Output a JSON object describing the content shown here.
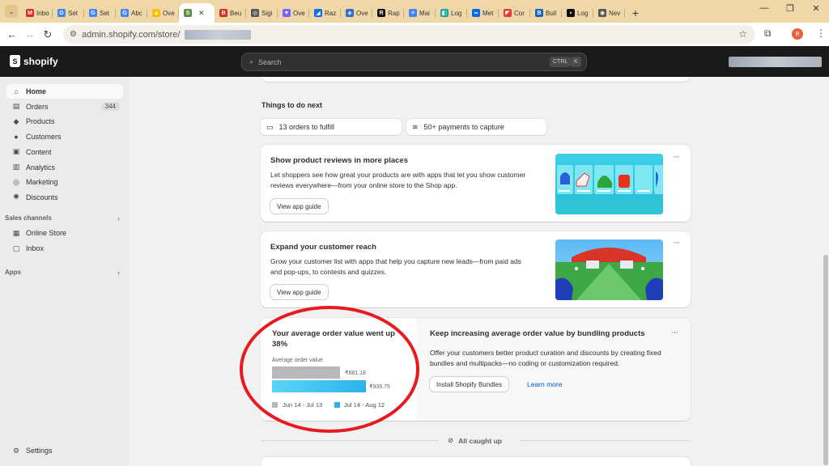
{
  "browser": {
    "tabs": [
      {
        "label": "Inbo",
        "icon": "gmail-icon",
        "color": "#d93025",
        "glyph": "M"
      },
      {
        "label": "Set",
        "icon": "google-icon",
        "color": "#4285f4",
        "glyph": "G"
      },
      {
        "label": "Set",
        "icon": "google-icon",
        "color": "#4285f4",
        "glyph": "G"
      },
      {
        "label": "Abc",
        "icon": "google-icon",
        "color": "#4285f4",
        "glyph": "G"
      },
      {
        "label": "Ove",
        "icon": "google-ads-icon",
        "color": "#fbbc04",
        "glyph": "▲"
      },
      {
        "label": "",
        "icon": "shopify-icon",
        "color": "#5e8e3e",
        "glyph": "S",
        "active": true
      },
      {
        "label": "Beu",
        "icon": "app-icon",
        "color": "#d93025",
        "glyph": "B"
      },
      {
        "label": "Sigi",
        "icon": "globe-icon",
        "color": "#555555",
        "glyph": "◎"
      },
      {
        "label": "Ove",
        "icon": "app-icon",
        "color": "#7b61ff",
        "glyph": "▼"
      },
      {
        "label": "Raz",
        "icon": "razorpay-icon",
        "color": "#0c6ded",
        "glyph": "◢"
      },
      {
        "label": "Ove",
        "icon": "app-icon",
        "color": "#2c6ecb",
        "glyph": "◈"
      },
      {
        "label": "Rap",
        "icon": "app-icon",
        "color": "#111111",
        "glyph": "R"
      },
      {
        "label": "Mai",
        "icon": "docs-icon",
        "color": "#4285f4",
        "glyph": "≡"
      },
      {
        "label": "Log",
        "icon": "app-icon",
        "color": "#1aa3a3",
        "glyph": "◧"
      },
      {
        "label": "Met",
        "icon": "meta-icon",
        "color": "#0866ff",
        "glyph": "∞"
      },
      {
        "label": "Cor",
        "icon": "app-icon",
        "color": "#e53935",
        "glyph": "◤"
      },
      {
        "label": "Buil",
        "icon": "app-icon",
        "color": "#1565c0",
        "glyph": "B"
      },
      {
        "label": "Log",
        "icon": "app-icon",
        "color": "#111111",
        "glyph": "▪"
      },
      {
        "label": "Nev",
        "icon": "chrome-icon",
        "color": "#555555",
        "glyph": "◉"
      }
    ],
    "url": "admin.shopify.com/store/",
    "profile_initial": "B"
  },
  "topbar": {
    "brand": "shopify",
    "search_placeholder": "Search",
    "shortcut_key1": "CTRL",
    "shortcut_key2": "K"
  },
  "sidebar": {
    "items": [
      {
        "label": "Home",
        "icon": "home-icon",
        "glyph": "⌂",
        "active": true
      },
      {
        "label": "Orders",
        "icon": "orders-icon",
        "glyph": "▤",
        "badge": "344"
      },
      {
        "label": "Products",
        "icon": "tag-icon",
        "glyph": "◆"
      },
      {
        "label": "Customers",
        "icon": "person-icon",
        "glyph": "●"
      },
      {
        "label": "Content",
        "icon": "content-icon",
        "glyph": "▣"
      },
      {
        "label": "Analytics",
        "icon": "analytics-icon",
        "glyph": "▥"
      },
      {
        "label": "Marketing",
        "icon": "target-icon",
        "glyph": "◎"
      },
      {
        "label": "Discounts",
        "icon": "discount-icon",
        "glyph": "✺"
      }
    ],
    "sales_channels_heading": "Sales channels",
    "channels": [
      {
        "label": "Online Store",
        "icon": "store-icon",
        "glyph": "▦"
      },
      {
        "label": "Inbox",
        "icon": "inbox-icon",
        "glyph": "▢"
      }
    ],
    "apps_heading": "Apps",
    "settings_label": "Settings"
  },
  "main": {
    "things_title": "Things to do next",
    "pills": [
      {
        "label": "13 orders to fulfill",
        "icon": "inbox-tray-icon",
        "glyph": "▭"
      },
      {
        "label": "50+ payments to capture",
        "icon": "cash-icon",
        "glyph": "≋"
      }
    ],
    "cards": [
      {
        "title": "Show product reviews in more places",
        "description": "Let shoppers see how great your products are with apps that let you show customer reviews everywhere—from your online store to the Shop app.",
        "button": "View app guide"
      },
      {
        "title": "Expand your customer reach",
        "description": "Grow your customer list with apps that help you capture new leads—from paid ads and pop-ups, to contests and quizzes.",
        "button": "View app guide"
      }
    ],
    "aov": {
      "headline": "Your average order value went up 38%",
      "label": "Average order value",
      "prev_value": "₹681.18",
      "cur_value": "₹939.75",
      "prev_period": "Jun 14 - Jul 13",
      "cur_period": "Jul 14 - Aug 12",
      "prev_color": "#b9b9bd",
      "cur_color": "#2ab4ec",
      "title": "Keep increasing average order value by bundling products",
      "description": "Offer your customers better product curation and discounts by creating fixed bundles and multipacks—no coding or customization required.",
      "button": "Install Shopify Bundles",
      "link": "Learn more"
    },
    "caught_up": "All caught up"
  }
}
